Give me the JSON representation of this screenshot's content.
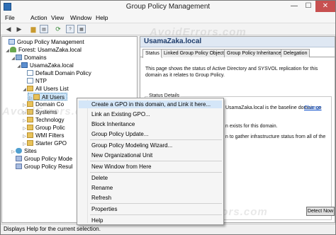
{
  "window": {
    "title": "Group Policy Management",
    "controls": {
      "minimize": "—",
      "maximize": "☐",
      "close": "✕"
    }
  },
  "menubar": {
    "items": [
      "File",
      "Action",
      "View",
      "Window",
      "Help"
    ]
  },
  "toolbar": {
    "icons": [
      "back-arrow-icon",
      "forward-arrow-icon",
      "folder-icon",
      "console-tree-icon",
      "refresh-icon",
      "help-icon",
      "properties-icon"
    ]
  },
  "tree": {
    "root": "Group Policy Management",
    "forest": "Forest: UsamaZaka.local",
    "domains": "Domains",
    "domain": "UsamaZaka.local",
    "ddp": "Default Domain Policy",
    "ntp": "NTP",
    "users_list": "All Users List",
    "all_users": "All Users",
    "domain_co": "Domain Co",
    "systems": "Systems",
    "technology": "Technology",
    "group_poli": "Group Polic",
    "wmi": "WMI Filters",
    "starter": "Starter GPO",
    "sites": "Sites",
    "modeling": "Group Policy Mode",
    "results": "Group Policy Resul"
  },
  "right": {
    "header": "UsamaZaka.local",
    "tabs": [
      "Status",
      "Linked Group Policy Objects",
      "Group Policy Inheritance",
      "Delegation"
    ],
    "desc_1": "This page shows the status of Active Directory and SYSVOL replication for this",
    "desc_2": "domain as it relates to Group Policy.",
    "section": "Status Details",
    "line_baseline": "UsamaZaka.local is the baseline domain co",
    "change_link": "Change",
    "line_exists": "n exists for this domain.",
    "line_gather": "n to gather infrastructure status from all of the",
    "detect_button": "Detect Now"
  },
  "context_menu": {
    "create_gpo": "Create a GPO in this domain, and Link it here...",
    "link_gpo": "Link an Existing GPO...",
    "block": "Block Inheritance",
    "update": "Group Policy Update...",
    "wizard": "Group Policy Modeling Wizard...",
    "new_ou": "New Organizational Unit",
    "new_window": "New Window from Here",
    "delete": "Delete",
    "rename": "Rename",
    "refresh": "Refresh",
    "properties": "Properties",
    "help": "Help"
  },
  "status_bar": {
    "text": "Displays Help for the current selection."
  },
  "watermark": "AvoidErrors.com"
}
